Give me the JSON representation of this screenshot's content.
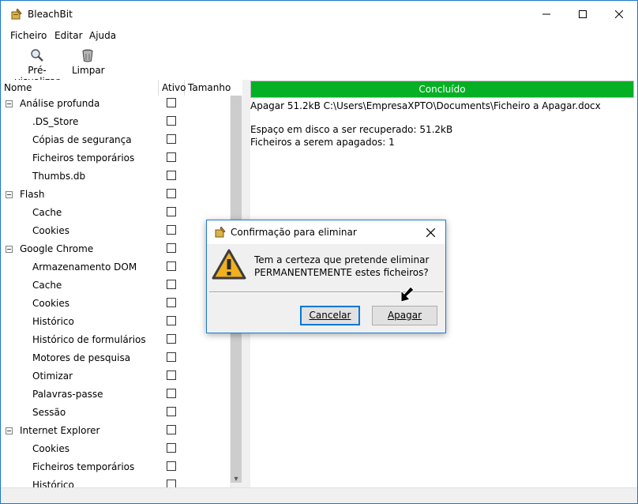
{
  "window": {
    "title": "BleachBit",
    "icon": "bleachbit-broom-icon"
  },
  "menu": {
    "items": [
      {
        "label": "Ficheiro"
      },
      {
        "label": "Editar"
      },
      {
        "label": "Ajuda"
      }
    ]
  },
  "toolbar": {
    "preview_label": "Pré-visualizar",
    "clean_label": "Limpar"
  },
  "tree": {
    "columns": {
      "name": "Nome",
      "active": "Ativo",
      "size": "Tamanho"
    },
    "rows": [
      {
        "label": "Análise profunda",
        "level": 0
      },
      {
        "label": ".DS_Store",
        "level": 1
      },
      {
        "label": "Cópias de segurança",
        "level": 1
      },
      {
        "label": "Ficheiros temporários",
        "level": 1
      },
      {
        "label": "Thumbs.db",
        "level": 1
      },
      {
        "label": "Flash",
        "level": 0
      },
      {
        "label": "Cache",
        "level": 1
      },
      {
        "label": "Cookies",
        "level": 1
      },
      {
        "label": "Google Chrome",
        "level": 0
      },
      {
        "label": "Armazenamento DOM",
        "level": 1
      },
      {
        "label": "Cache",
        "level": 1
      },
      {
        "label": "Cookies",
        "level": 1
      },
      {
        "label": "Histórico",
        "level": 1
      },
      {
        "label": "Histórico de formulários",
        "level": 1
      },
      {
        "label": "Motores de pesquisa",
        "level": 1
      },
      {
        "label": "Otimizar",
        "level": 1
      },
      {
        "label": "Palavras-passe",
        "level": 1
      },
      {
        "label": "Sessão",
        "level": 1
      },
      {
        "label": "Internet Explorer",
        "level": 0
      },
      {
        "label": "Cookies",
        "level": 1
      },
      {
        "label": "Ficheiros temporários",
        "level": 1
      },
      {
        "label": "Histórico",
        "level": 1
      }
    ]
  },
  "progress": {
    "label": "Concluído",
    "value": 1.0,
    "color": "#06b025"
  },
  "log": {
    "lines": [
      "Apagar 51.2kB C:\\Users\\EmpresaXPTO\\Documents\\Ficheiro a Apagar.docx",
      "Espaço em disco a ser recuperado: 51.2kB",
      "Ficheiros a serem apagados: 1"
    ]
  },
  "dialog": {
    "title": "Confirmação para eliminar",
    "message_line1": "Tem a certeza que pretende eliminar",
    "message_line2": "PERMANENTEMENTE estes ficheiros?",
    "cancel_label": "Cancelar",
    "delete_label": "Apagar",
    "accent": "#0078d7"
  }
}
